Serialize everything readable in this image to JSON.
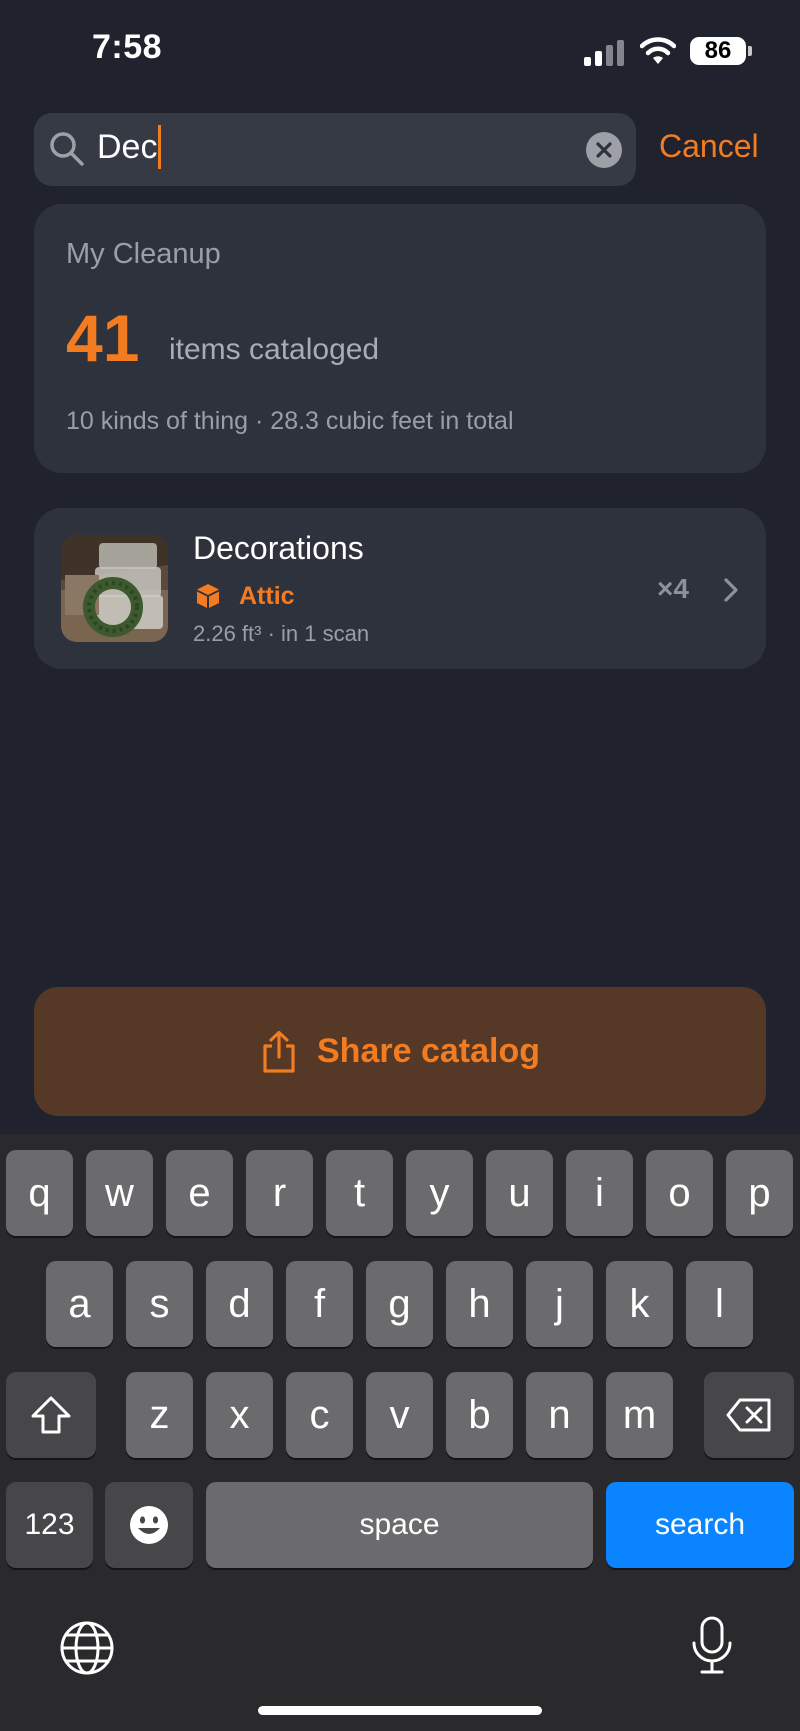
{
  "status": {
    "time": "7:58",
    "battery": "86"
  },
  "search": {
    "query": "Dec",
    "cancel_label": "Cancel"
  },
  "summary": {
    "title": "My Cleanup",
    "count": "41",
    "count_label": "items cataloged",
    "subtitle": "10 kinds of thing · 28.3 cubic feet in total"
  },
  "results": [
    {
      "name": "Decorations",
      "location": "Attic",
      "meta": "2.26 ft³ · in 1 scan",
      "quantity": "×4",
      "thumbnail_icon": "storage-bins-wreath-photo"
    }
  ],
  "share": {
    "label": "Share catalog",
    "icon": "share-icon"
  },
  "keyboard": {
    "row1": [
      "q",
      "w",
      "e",
      "r",
      "t",
      "y",
      "u",
      "i",
      "o",
      "p"
    ],
    "row2": [
      "a",
      "s",
      "d",
      "f",
      "g",
      "h",
      "j",
      "k",
      "l"
    ],
    "row3": [
      "z",
      "x",
      "c",
      "v",
      "b",
      "n",
      "m"
    ],
    "numbers_label": "123",
    "space_label": "space",
    "search_label": "search"
  },
  "colors": {
    "accent": "#f47c20",
    "background": "#20232d",
    "card": "#2e323d",
    "return_key": "#0a84ff"
  }
}
